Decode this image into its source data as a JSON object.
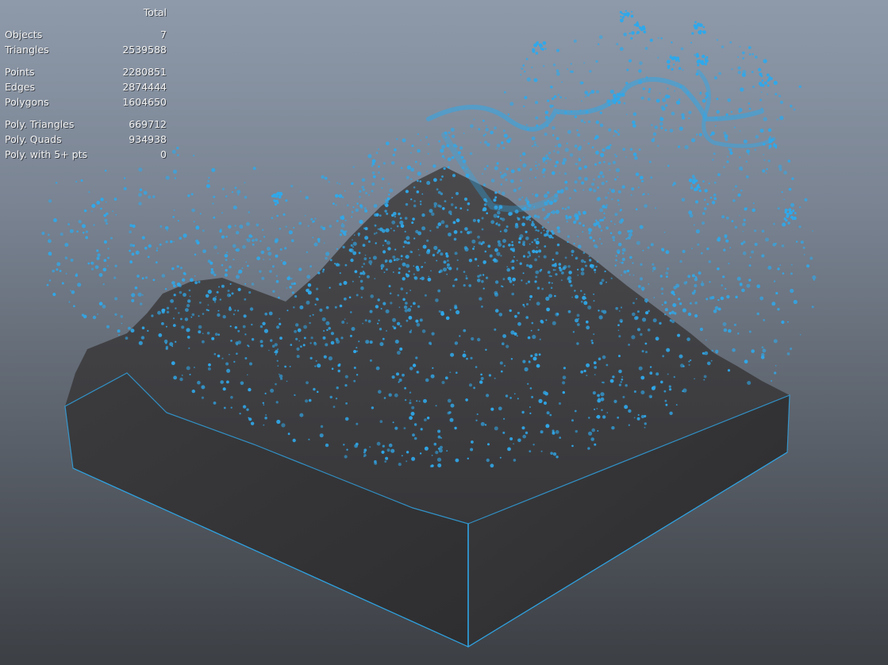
{
  "hud": {
    "column_header": "Total",
    "groups": [
      {
        "rows": [
          {
            "label": "Objects",
            "value": "7"
          },
          {
            "label": "Triangles",
            "value": "2539588"
          }
        ]
      },
      {
        "rows": [
          {
            "label": "Points",
            "value": "2280851"
          },
          {
            "label": "Edges",
            "value": "2874444"
          },
          {
            "label": "Polygons",
            "value": "1604650"
          }
        ]
      },
      {
        "rows": [
          {
            "label": "Poly. Triangles",
            "value": "669712"
          },
          {
            "label": "Poly. Quads",
            "value": "934938"
          },
          {
            "label": "Poly. with 5+ pts",
            "value": "0"
          }
        ]
      }
    ]
  },
  "colors": {
    "particle": "#2fa8ea",
    "mesh": "#3a3a3c",
    "background_top": "#8e9aaa",
    "background_bottom": "#3c3f44"
  }
}
